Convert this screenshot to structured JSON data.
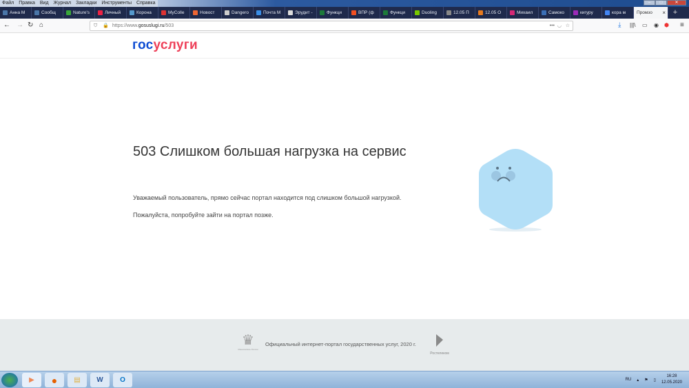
{
  "menu": [
    "Файл",
    "Правка",
    "Вид",
    "Журнал",
    "Закладки",
    "Инструменты",
    "Справка"
  ],
  "tabs": [
    {
      "label": "Анна М",
      "color": "#4a76a8"
    },
    {
      "label": "Сообщ",
      "color": "#4a76a8"
    },
    {
      "label": "Nature's",
      "color": "#3aa83a"
    },
    {
      "label": "Личный",
      "color": "#e24"
    },
    {
      "label": "Корона",
      "color": "#59c"
    },
    {
      "label": "MyColle",
      "color": "#d33"
    },
    {
      "label": "Новост",
      "color": "#e63"
    },
    {
      "label": "Dangero",
      "color": "#ccc"
    },
    {
      "label": "Почта М",
      "color": "#3a8ee6"
    },
    {
      "label": "Эрудит -",
      "color": "#ddd"
    },
    {
      "label": "Функци",
      "color": "#1d7a3a"
    },
    {
      "label": "ВПР (ф",
      "color": "#f25022"
    },
    {
      "label": "Функци",
      "color": "#1d7a3a"
    },
    {
      "label": "Duoling",
      "color": "#78c800"
    },
    {
      "label": "12.05 П",
      "color": "#888"
    },
    {
      "label": "12.05 О",
      "color": "#e87a1e"
    },
    {
      "label": "Михаил",
      "color": "#d62976"
    },
    {
      "label": "Самоко",
      "color": "#3b6fb6"
    },
    {
      "label": "кигуру",
      "color": "#9b2bb8"
    },
    {
      "label": "кора м",
      "color": "#4285f4"
    }
  ],
  "active_tab": {
    "label": "Промзо"
  },
  "url": {
    "prefix": "https://www.",
    "domain": "gosuslugi.ru",
    "path": "/503"
  },
  "logo": {
    "part1": "гос",
    "part2": "услуги"
  },
  "error": {
    "title": "503 Слишком большая нагрузка на сервис",
    "message1": "Уважаемый пользователь, прямо сейчас портал находится под слишком большой нагрузкой.",
    "message2": "Пожалуйста, попробуйте зайти на портал позже."
  },
  "footer": {
    "text": "Официальный интернет-портал государственных услуг, 2020 г.",
    "left_logo": "Минкомсвязь России",
    "right_logo": "Ростелеком"
  },
  "tray": {
    "lang": "RU",
    "time": "16:28",
    "date": "12.05.2020"
  },
  "colors": {
    "brand_blue": "#0d4cd3",
    "brand_red": "#ee3f58",
    "sad_face": "#b3dff7"
  }
}
